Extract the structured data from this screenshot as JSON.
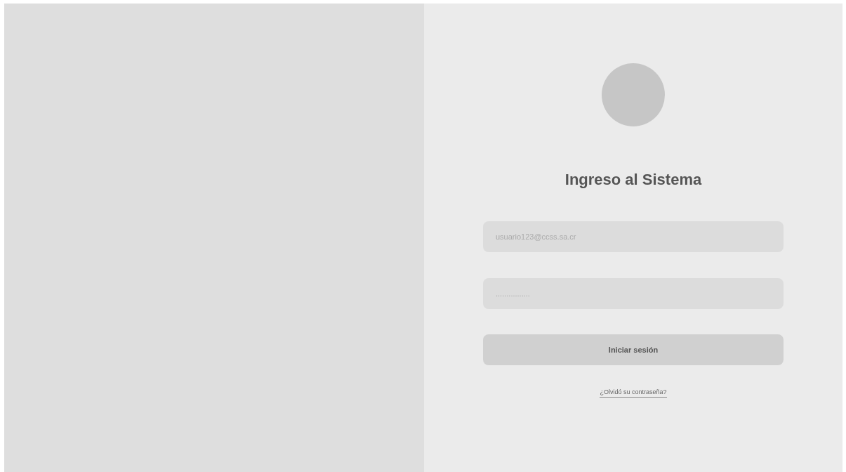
{
  "login": {
    "title": "Ingreso al Sistema",
    "email": {
      "placeholder": "usuario123@ccss.sa.cr"
    },
    "password": {
      "placeholder": "................"
    },
    "submit": "Iniciar sesión",
    "forgot_link": "¿Olvidó su contraseña?"
  }
}
